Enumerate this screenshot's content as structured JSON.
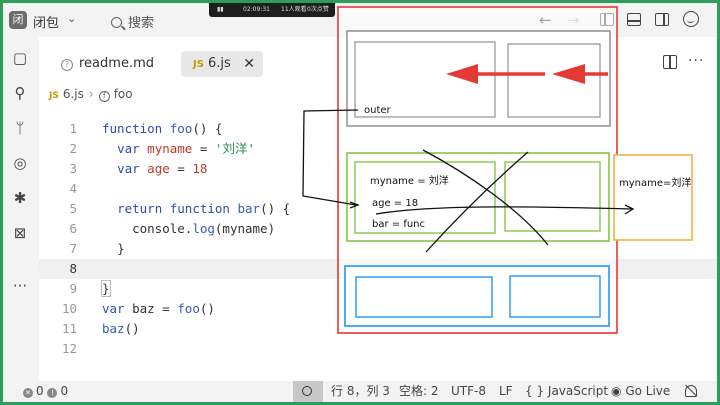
{
  "window": {
    "app_logo": "闭",
    "app_name": "闭包",
    "search_label": "搜索",
    "phone_status": {
      "time": "02:09:31",
      "viewers": "11人观看",
      "likes": "0次点赞"
    },
    "nav_back": "←",
    "nav_forward": "→"
  },
  "activity_bar": {
    "items": [
      "files-icon",
      "search-icon",
      "source-control-icon",
      "run-debug-icon",
      "bug-icon",
      "remote-icon",
      "more-icon"
    ],
    "more": "···"
  },
  "tabs": [
    {
      "label": "readme.md",
      "icon": "question-icon",
      "active": false
    },
    {
      "label": "6.js",
      "badge": "JS",
      "active": true,
      "close": "✕"
    }
  ],
  "breadcrumb": {
    "file_badge": "JS",
    "file": "6.js",
    "separator": "›",
    "symbol": "foo"
  },
  "editor": {
    "current_line": 8,
    "line_numbers": [
      "1",
      "2",
      "3",
      "4",
      "5",
      "6",
      "7",
      "8",
      "9",
      "10",
      "11",
      "12"
    ]
  },
  "statusbar": {
    "errors": "0",
    "warnings": "0",
    "position": "行 8，列 3",
    "spaces": "空格: 2",
    "encoding": "UTF-8",
    "eol": "LF",
    "language": "{ } JavaScript",
    "golive": "Go Live"
  },
  "annotations": {
    "outer": "outer",
    "myname": "myname = 刘洋",
    "age": "age = 18",
    "bar": "bar = func",
    "closure": "myname=刘洋",
    "colors": {
      "red": "#e53935",
      "green": "#8bc34a",
      "blue": "#2196f3",
      "orange": "#f5b041",
      "gray": "#888888"
    }
  }
}
